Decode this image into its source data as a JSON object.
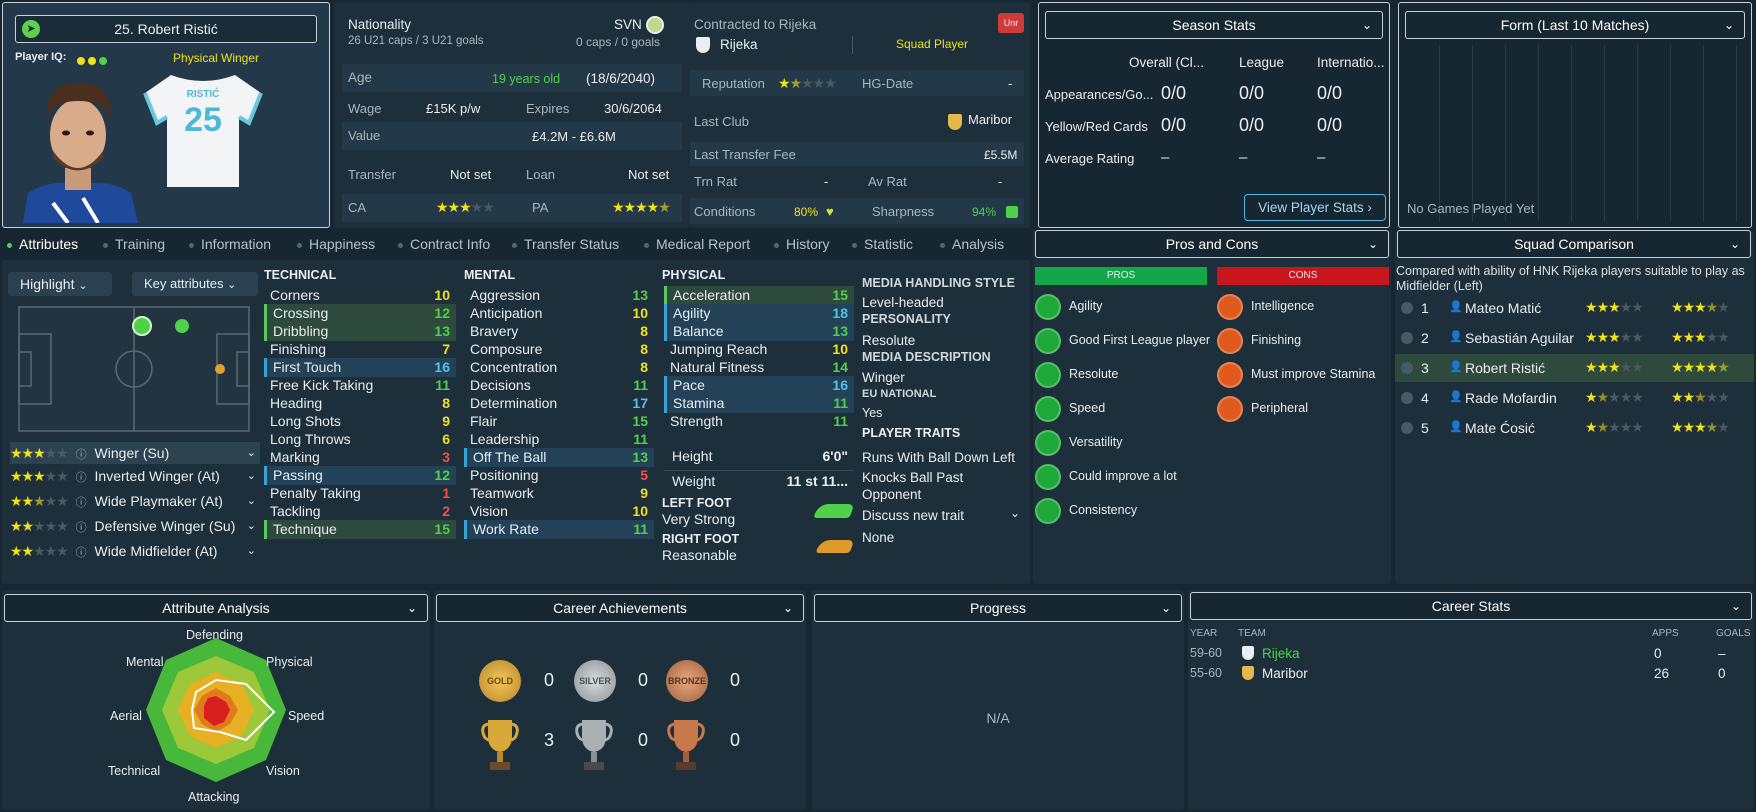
{
  "player": {
    "title": "25. Robert Ristić",
    "iq_label": "Player IQ:",
    "role": "Physical Winger",
    "shirt_name": "RISTIĆ",
    "shirt_number": "25"
  },
  "info": {
    "nationality_label": "Nationality",
    "nationality_code": "SVN",
    "u21": "26 U21 caps / 3 U21 goals",
    "caps": "0 caps / 0 goals",
    "age_label": "Age",
    "age_value": "19 years old",
    "age_date": "(18/6/2040)",
    "wage_label": "Wage",
    "wage_value": "£15K p/w",
    "expires_label": "Expires",
    "expires_value": "30/6/2064",
    "value_label": "Value",
    "value_value": "£4.2M - £6.6M",
    "transfer_label": "Transfer",
    "transfer_value": "Not set",
    "loan_label": "Loan",
    "loan_value": "Not set",
    "ca_label": "CA",
    "pa_label": "PA",
    "ca_stars": 3,
    "pa_stars": 4.5
  },
  "contract": {
    "contracted_label": "Contracted to Rijeka",
    "badge": "Unr",
    "club": "Rijeka",
    "status": "Squad Player",
    "reputation_label": "Reputation",
    "reputation_stars": 1.5,
    "hg_label": "HG-Date",
    "hg_value": "-",
    "last_club_label": "Last Club",
    "last_club_value": "Maribor",
    "last_fee_label": "Last Transfer Fee",
    "last_fee_value": "£5.5M",
    "trn_label": "Trn Rat",
    "trn_value": "-",
    "av_label": "Av Rat",
    "av_value": "-",
    "conditions_label": "Conditions",
    "conditions_value": "80%",
    "sharpness_label": "Sharpness",
    "sharpness_value": "94%"
  },
  "season": {
    "title": "Season Stats",
    "cols": [
      "Overall (Cl...",
      "League",
      "Internatio..."
    ],
    "rows": [
      {
        "label": "Appearances/Go...",
        "v": [
          "0/0",
          "0/0",
          "0/0"
        ]
      },
      {
        "label": "Yellow/Red Cards",
        "v": [
          "0/0",
          "0/0",
          "0/0"
        ]
      },
      {
        "label": "Average Rating",
        "v": [
          "–",
          "–",
          "–"
        ]
      }
    ],
    "button": "View Player Stats"
  },
  "form": {
    "title": "Form (Last 10 Matches)",
    "empty": "No Games Played Yet"
  },
  "tabs": [
    "Attributes",
    "Training",
    "Information",
    "Happiness",
    "Contract Info",
    "Transfer Status",
    "Medical Report",
    "History",
    "Statistic",
    "Analysis"
  ],
  "controls": {
    "highlight": "Highlight",
    "key": "Key attributes"
  },
  "roles": [
    {
      "stars": 3,
      "label": "Winger (Su)"
    },
    {
      "stars": 3,
      "label": "Inverted Winger (At)"
    },
    {
      "stars": 2.5,
      "label": "Wide Playmaker (At)"
    },
    {
      "stars": 2,
      "label": "Defensive Winger (Su)"
    },
    {
      "stars": 2,
      "label": "Wide Midfielder (At)"
    }
  ],
  "technical": {
    "title": "TECHNICAL",
    "items": [
      {
        "n": "Corners",
        "v": "10",
        "c": "y",
        "h": ""
      },
      {
        "n": "Crossing",
        "v": "12",
        "c": "g",
        "h": "g"
      },
      {
        "n": "Dribbling",
        "v": "13",
        "c": "g",
        "h": "g"
      },
      {
        "n": "Finishing",
        "v": "7",
        "c": "y",
        "h": ""
      },
      {
        "n": "First Touch",
        "v": "16",
        "c": "c",
        "h": "b"
      },
      {
        "n": "Free Kick Taking",
        "v": "11",
        "c": "g",
        "h": ""
      },
      {
        "n": "Heading",
        "v": "8",
        "c": "y",
        "h": ""
      },
      {
        "n": "Long Shots",
        "v": "9",
        "c": "y",
        "h": ""
      },
      {
        "n": "Long Throws",
        "v": "6",
        "c": "y",
        "h": ""
      },
      {
        "n": "Marking",
        "v": "3",
        "c": "r",
        "h": ""
      },
      {
        "n": "Passing",
        "v": "12",
        "c": "g",
        "h": "b"
      },
      {
        "n": "Penalty Taking",
        "v": "1",
        "c": "r",
        "h": ""
      },
      {
        "n": "Tackling",
        "v": "2",
        "c": "r",
        "h": ""
      },
      {
        "n": "Technique",
        "v": "15",
        "c": "g",
        "h": "g"
      }
    ]
  },
  "mental": {
    "title": "MENTAL",
    "items": [
      {
        "n": "Aggression",
        "v": "13",
        "c": "g",
        "h": ""
      },
      {
        "n": "Anticipation",
        "v": "10",
        "c": "y",
        "h": ""
      },
      {
        "n": "Bravery",
        "v": "8",
        "c": "y",
        "h": ""
      },
      {
        "n": "Composure",
        "v": "8",
        "c": "y",
        "h": ""
      },
      {
        "n": "Concentration",
        "v": "8",
        "c": "y",
        "h": ""
      },
      {
        "n": "Decisions",
        "v": "11",
        "c": "g",
        "h": ""
      },
      {
        "n": "Determination",
        "v": "17",
        "c": "c",
        "h": ""
      },
      {
        "n": "Flair",
        "v": "15",
        "c": "g",
        "h": ""
      },
      {
        "n": "Leadership",
        "v": "11",
        "c": "g",
        "h": ""
      },
      {
        "n": "Off The Ball",
        "v": "13",
        "c": "g",
        "h": "b"
      },
      {
        "n": "Positioning",
        "v": "5",
        "c": "r",
        "h": ""
      },
      {
        "n": "Teamwork",
        "v": "9",
        "c": "y",
        "h": ""
      },
      {
        "n": "Vision",
        "v": "10",
        "c": "y",
        "h": ""
      },
      {
        "n": "Work Rate",
        "v": "11",
        "c": "g",
        "h": "b"
      }
    ]
  },
  "physical": {
    "title": "PHYSICAL",
    "items": [
      {
        "n": "Acceleration",
        "v": "15",
        "c": "g",
        "h": "g"
      },
      {
        "n": "Agility",
        "v": "18",
        "c": "c",
        "h": "b"
      },
      {
        "n": "Balance",
        "v": "13",
        "c": "g",
        "h": "b"
      },
      {
        "n": "Jumping Reach",
        "v": "10",
        "c": "y",
        "h": ""
      },
      {
        "n": "Natural Fitness",
        "v": "14",
        "c": "g",
        "h": ""
      },
      {
        "n": "Pace",
        "v": "16",
        "c": "c",
        "h": "b"
      },
      {
        "n": "Stamina",
        "v": "11",
        "c": "g",
        "h": "b"
      },
      {
        "n": "Strength",
        "v": "11",
        "c": "g",
        "h": ""
      }
    ],
    "height_label": "Height",
    "height_value": "6'0\"",
    "weight_label": "Weight",
    "weight_value": "11 st 11...",
    "left_foot_label": "LEFT FOOT",
    "left_foot_value": "Very Strong",
    "right_foot_label": "RIGHT FOOT",
    "right_foot_value": "Reasonable"
  },
  "media": {
    "mhs_label": "MEDIA HANDLING STYLE",
    "mhs_value": "Level-headed",
    "pers_label": "PERSONALITY",
    "pers_value": "Resolute",
    "desc_label": "MEDIA DESCRIPTION",
    "desc_value": "Winger",
    "eu_label": "EU NATIONAL",
    "eu_value": "Yes",
    "traits_label": "PLAYER TRAITS",
    "traits": [
      "Runs With Ball Down Left",
      "Knocks Ball Past Opponent"
    ],
    "discuss": "Discuss new trait",
    "none": "None"
  },
  "pros_cons": {
    "title": "Pros and Cons",
    "pros_label": "PROS",
    "cons_label": "CONS",
    "pros": [
      "Agility",
      "Good First League player",
      "Resolute",
      "Speed",
      "Versatility",
      "Could improve a lot",
      "Consistency"
    ],
    "cons": [
      "Intelligence",
      "Finishing",
      "Must improve Stamina",
      "Peripheral"
    ],
    "pros_color": "#12a84a",
    "cons_color": "#c8161c"
  },
  "squad": {
    "title": "Squad Comparison",
    "desc": "Compared with ability of HNK Rijeka players suitable to play as Midfielder (Left)",
    "rows": [
      {
        "rank": "1",
        "name": "Mateo Matić",
        "ca": 3,
        "pa": 3.5
      },
      {
        "rank": "2",
        "name": "Sebastián Aguilar",
        "ca": 3,
        "pa": 3
      },
      {
        "rank": "3",
        "name": "Robert Ristić",
        "ca": 3,
        "pa": 4.5
      },
      {
        "rank": "4",
        "name": "Rade Mofardin",
        "ca": 1.5,
        "pa": 2.5
      },
      {
        "rank": "5",
        "name": "Mate Ćosić",
        "ca": 1.5,
        "pa": 3.5
      }
    ]
  },
  "analysis": {
    "title": "Attribute Analysis",
    "labels": [
      "Defending",
      "Physical",
      "Speed",
      "Vision",
      "Attacking",
      "Technical",
      "Aerial",
      "Mental"
    ]
  },
  "achievements": {
    "title": "Career Achievements",
    "medals": [
      {
        "label": "GOLD",
        "count": "0"
      },
      {
        "label": "SILVER",
        "count": "0"
      },
      {
        "label": "BRONZE",
        "count": "0"
      }
    ],
    "trophies": [
      "3",
      "0",
      "0"
    ]
  },
  "progress": {
    "title": "Progress",
    "empty": "N/A"
  },
  "career": {
    "title": "Career Stats",
    "cols": [
      "YEAR",
      "TEAM",
      "APPS",
      "GOALS"
    ],
    "rows": [
      {
        "year": "59-60",
        "team": "Rijeka",
        "apps": "0",
        "goals": "–"
      },
      {
        "year": "55-60",
        "team": "Maribor",
        "apps": "26",
        "goals": "0"
      }
    ]
  }
}
